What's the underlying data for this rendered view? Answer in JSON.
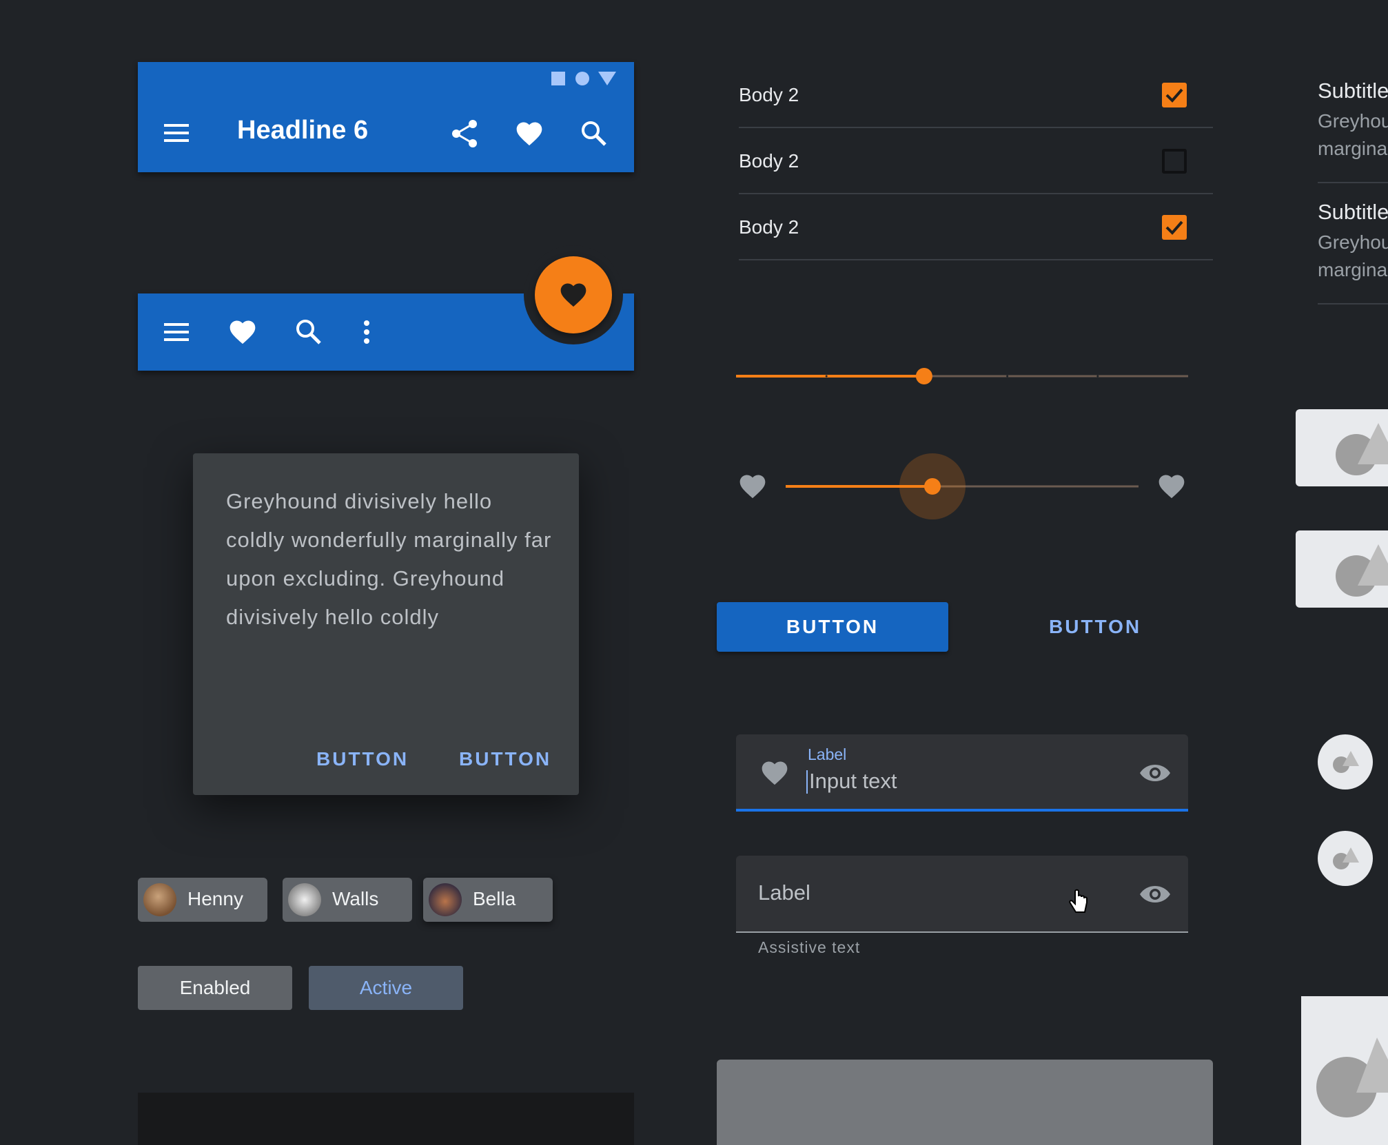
{
  "top_app_bar": {
    "title": "Headline 6",
    "status_icons": [
      "square-icon",
      "circle-icon",
      "triangle-icon"
    ],
    "actions": [
      "menu-icon",
      "share-icon",
      "heart-icon",
      "search-icon"
    ]
  },
  "bottom_app_bar": {
    "actions": [
      "menu-icon",
      "heart-icon",
      "search-icon",
      "more-vert-icon"
    ],
    "fab_icon": "heart-icon"
  },
  "dialog": {
    "body": "Greyhound divisively hello coldly wonderfully marginally far upon excluding. Greyhound divisively hello coldly",
    "buttons": [
      "BUTTON",
      "BUTTON"
    ]
  },
  "chips": [
    {
      "label": "Henny"
    },
    {
      "label": "Walls"
    },
    {
      "label": "Bella"
    }
  ],
  "toggle_chips": {
    "enabled": "Enabled",
    "active": "Active"
  },
  "checkbox_list": [
    {
      "label": "Body 2",
      "checked": true
    },
    {
      "label": "Body 2",
      "checked": false
    },
    {
      "label": "Body 2",
      "checked": true
    }
  ],
  "discrete_slider": {
    "value": 0.416,
    "steps": 5
  },
  "continuous_slider": {
    "value": 0.416,
    "left_icon": "heart-icon",
    "right_icon": "heart-icon"
  },
  "buttons": {
    "contained": "BUTTON",
    "text": "BUTTON"
  },
  "text_field_filled": {
    "label": "Label",
    "value": "Input text",
    "leading_icon": "heart-icon",
    "trailing_icon": "eye-icon"
  },
  "text_field_empty": {
    "label": "Label",
    "assistive": "Assistive text",
    "trailing_icon": "eye-icon"
  },
  "right_list": [
    {
      "title": "Subtitle",
      "line1": "Greyhou",
      "line2": "margina"
    },
    {
      "title": "Subtitle",
      "line1": "Greyhou",
      "line2": "margina"
    }
  ],
  "colors": {
    "background": "#202327",
    "primary": "#1565c0",
    "accent": "#f57f17",
    "link": "#8ab4f8",
    "surface": "#3c4043"
  }
}
